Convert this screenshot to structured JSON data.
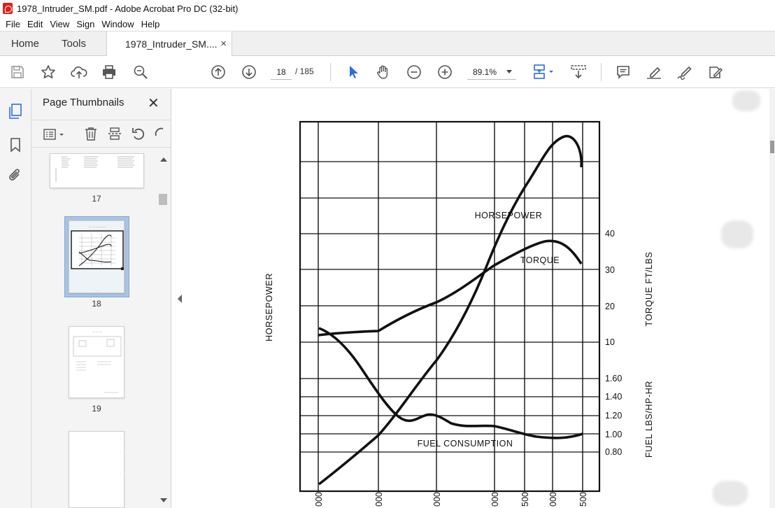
{
  "window": {
    "title": "1978_Intruder_SM.pdf - Adobe Acrobat Pro DC (32-bit)"
  },
  "menu": {
    "items": [
      "File",
      "Edit",
      "View",
      "Sign",
      "Window",
      "Help"
    ]
  },
  "tabs": {
    "home": "Home",
    "tools": "Tools",
    "document": "1978_Intruder_SM....",
    "close": "×"
  },
  "toolbar": {
    "current_page": "18",
    "page_total": "/ 185",
    "zoom": "89.1%"
  },
  "thumbnails_panel": {
    "title": "Page Thumbnails",
    "close": "✕",
    "pages": [
      {
        "number": "17"
      },
      {
        "number": "18",
        "selected": true
      },
      {
        "number": "19"
      },
      {
        "number": ""
      }
    ]
  },
  "chart_data": {
    "type": "line",
    "y_left_label": "HORSEPOWER",
    "y_right_label_top": "TORQUE FT/LBS",
    "y_right_label_bottom": "FUEL LBS/HP-HR",
    "torque_ticks": [
      "40",
      "30",
      "20",
      "10"
    ],
    "fuel_ticks": [
      "1.60",
      "1.40",
      "1.20",
      "1.00",
      "0.80"
    ],
    "x_tick_labels": [
      "000",
      "000",
      "000",
      "000",
      "500",
      "000",
      "500"
    ],
    "series": [
      {
        "name": "HORSEPOWER"
      },
      {
        "name": "TORQUE"
      },
      {
        "name": "FUEL CONSUMPTION"
      }
    ]
  }
}
